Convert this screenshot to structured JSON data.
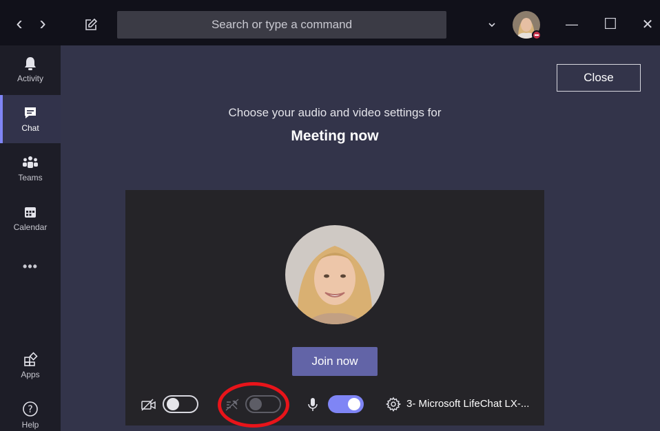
{
  "titlebar": {
    "back_glyph": "‹",
    "forward_glyph": "›",
    "search_placeholder": "Search or type a command",
    "minimize_glyph": "—",
    "maximize_glyph": "☐",
    "close_glyph": "✕",
    "presence_color": "#c4314b"
  },
  "sidebar": {
    "items": [
      {
        "label": "Activity",
        "icon": "bell-icon"
      },
      {
        "label": "Chat",
        "icon": "chat-icon",
        "active": true
      },
      {
        "label": "Teams",
        "icon": "teams-icon"
      },
      {
        "label": "Calendar",
        "icon": "calendar-icon"
      },
      {
        "label": "•••",
        "icon": "more-icon"
      },
      {
        "label": "Apps",
        "icon": "apps-icon"
      },
      {
        "label": "Help",
        "icon": "help-icon"
      }
    ]
  },
  "main": {
    "close_label": "Close",
    "subtitle": "Choose your audio and video settings for",
    "meeting_title": "Meeting now",
    "join_label": "Join now",
    "device_label": "3- Microsoft LifeChat LX-...",
    "video_toggle": "off",
    "blur_toggle": "disabled",
    "mic_toggle": "on"
  },
  "colors": {
    "accent": "#6264a7",
    "toggle_on": "#7f85f5",
    "annotation": "#e8141a",
    "background": "#33344a"
  }
}
